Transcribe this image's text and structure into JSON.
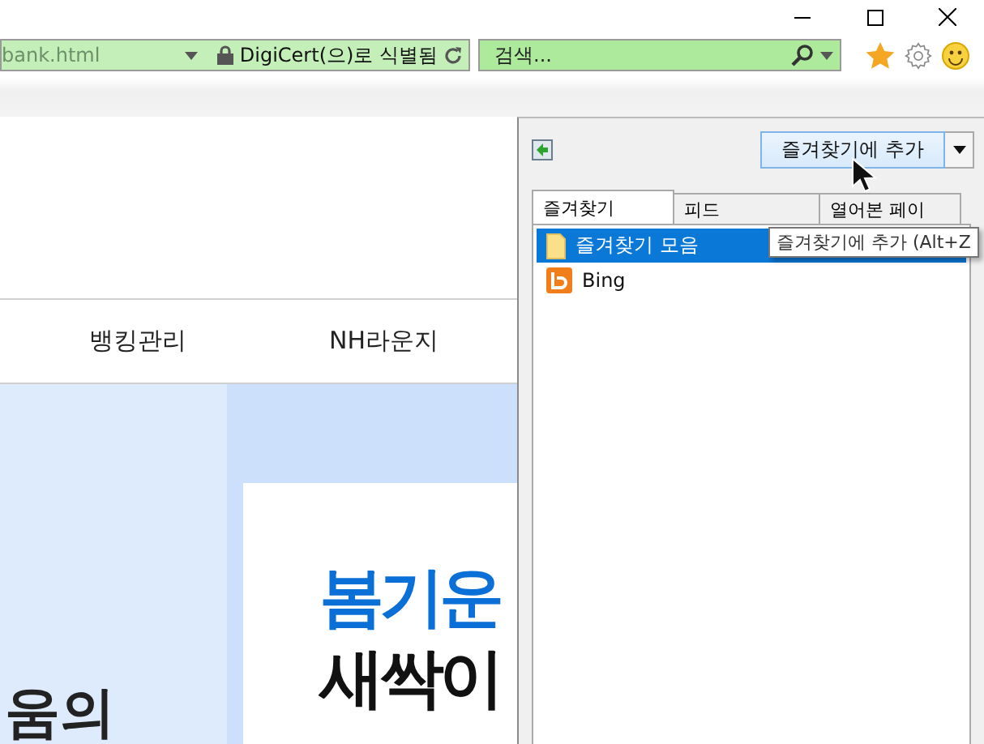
{
  "address_bar": {
    "url": "bank.html",
    "identity": "DigiCert(으)로 식별됨"
  },
  "search_field": {
    "placeholder": "검색..."
  },
  "page": {
    "nav_items": [
      "뱅킹관리",
      "NH라운지"
    ],
    "banner_left_text": "움의",
    "banner_headline": "봄기운",
    "banner_subline": "새싹이"
  },
  "favorites_center": {
    "add_button": "즐겨찾기에 추가",
    "tooltip": "즐겨찾기에 추가 (Alt+Z",
    "tabs": [
      {
        "label": "즐겨찾기",
        "selected": true
      },
      {
        "label": "피드",
        "selected": false
      },
      {
        "label": "열어본 페이",
        "selected": false
      }
    ],
    "items": [
      {
        "kind": "folder",
        "label": "즐겨찾기 모음",
        "selected": true
      },
      {
        "kind": "site",
        "label": "Bing",
        "selected": false
      }
    ]
  }
}
